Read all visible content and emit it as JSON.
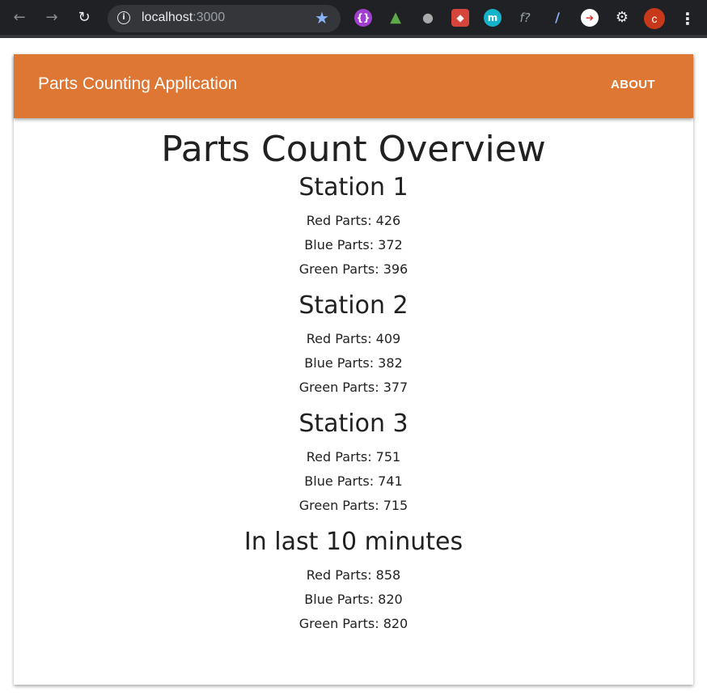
{
  "browser": {
    "url_host": "localhost",
    "url_port": ":3000",
    "avatar_initial": "c"
  },
  "app": {
    "title": "Parts Counting Application",
    "about_label": "ABOUT",
    "accent_color": "#de7634"
  },
  "page": {
    "title": "Parts Count Overview"
  },
  "sections": [
    {
      "title": "Station 1",
      "lines": [
        "Red Parts: 426",
        "Blue Parts: 372",
        "Green Parts: 396"
      ]
    },
    {
      "title": "Station 2",
      "lines": [
        "Red Parts: 409",
        "Blue Parts: 382",
        "Green Parts: 377"
      ]
    },
    {
      "title": "Station 3",
      "lines": [
        "Red Parts: 751",
        "Blue Parts: 741",
        "Green Parts: 715"
      ]
    },
    {
      "title": "In last 10 minutes",
      "lines": [
        "Red Parts: 858",
        "Blue Parts: 820",
        "Green Parts: 820"
      ]
    }
  ]
}
